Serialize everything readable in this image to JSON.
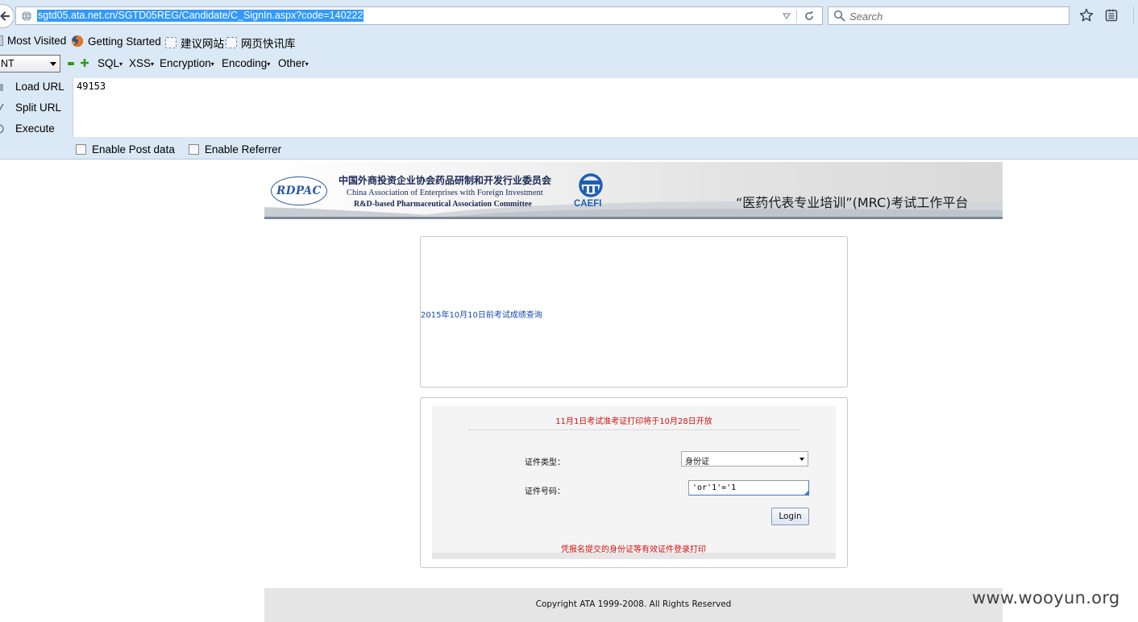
{
  "browser": {
    "url": "sgtd05.ata.net.cn/SGTD05REG/Candidate/C_SignIn.aspx?code=140222",
    "search_placeholder": "Search"
  },
  "bookmarks": [
    {
      "label": "Most Visited"
    },
    {
      "label": "Getting Started"
    },
    {
      "label": "建议网站"
    },
    {
      "label": "网页快讯库"
    }
  ],
  "hackbar": {
    "select_value": "NT",
    "menus": [
      "SQL",
      "XSS",
      "Encryption",
      "Encoding",
      "Other"
    ],
    "load_url": "Load URL",
    "split_url": "Split URL",
    "execute": "Execute",
    "url_value": "49153",
    "enable_post": "Enable Post data",
    "enable_referrer": "Enable Referrer"
  },
  "banner": {
    "logo_text": "RDPAC",
    "org_cn": "中国外商投资企业协会药品研制和开发行业委员会",
    "org_en_line1": "China Association of Enterprises with Foreign Investment",
    "org_en_line2": "R&D-based Pharmaceutical Association Committee",
    "caefi": "CAEFI",
    "platform_title": "“医药代表专业培训”(MRC)考试工作平台"
  },
  "query_box": {
    "link": "2015年10月10日前考试成绩查询"
  },
  "login_box": {
    "notice": "11月1日考试准考证打印将于10月28日开放",
    "id_type_label": "证件类型：",
    "id_type_value": "身份证",
    "id_number_label": "证件号码：",
    "id_number_value": "'or'1'='1",
    "login_button": "Login",
    "footnote": "凭报名提交的身份证等有效证件登录打印"
  },
  "footer": {
    "copyright": "Copyright ATA 1999-2008. All Rights Reserved"
  },
  "watermark": "www.wooyun.org",
  "colors": {
    "chrome_bg": "#dbe8f5",
    "url_highlight": "#3399ff",
    "notice_red": "#d01010",
    "link_blue": "#1a4aa8"
  }
}
